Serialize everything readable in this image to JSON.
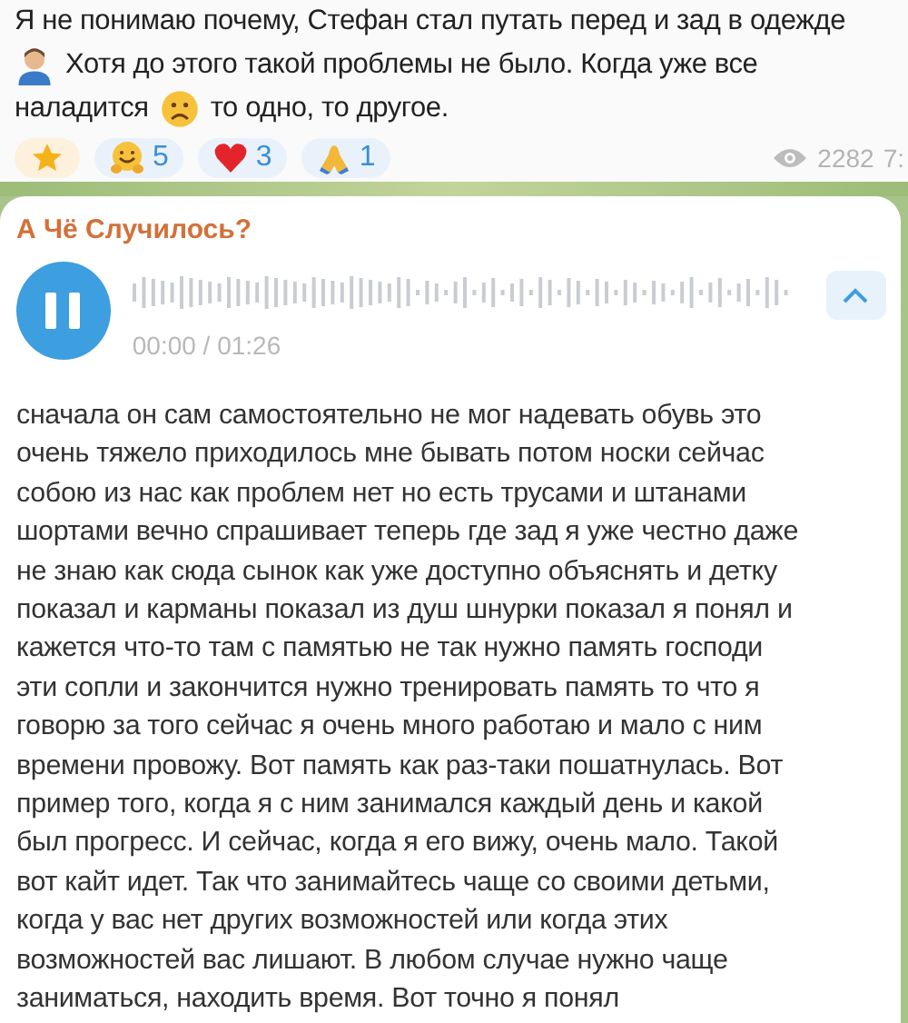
{
  "message": {
    "lines": [
      [
        {
          "kind": "text",
          "text": "Я не понимаю почему, Стефан стал путать перед и зад в одежде"
        }
      ],
      [
        {
          "kind": "person"
        },
        {
          "kind": "text",
          "text": "Хотя до этого такой проблемы не было. Когда уже все"
        }
      ],
      [
        {
          "kind": "text",
          "text": "наладится"
        },
        {
          "kind": "sad"
        },
        {
          "kind": "text",
          "text": "то одно, то другое."
        }
      ]
    ],
    "reactions": [
      {
        "kind": "star"
      },
      {
        "kind": "hug",
        "count": "5"
      },
      {
        "kind": "heart",
        "count": "3"
      },
      {
        "kind": "pray",
        "count": "1"
      }
    ],
    "views": "2282",
    "time": "7:"
  },
  "voice_message": {
    "sender": "А Чё Случилось?",
    "playing": true,
    "duration": "00:00 / 01:26",
    "transcript": [
      "сначала он сам самостоятельно не мог надевать обувь это",
      "очень тяжело приходилось мне бывать потом носки сейчас",
      "собою из нас как проблем нет но есть трусами и штанами",
      "шортами вечно спрашивает теперь где зад я уже честно даже",
      "не знаю как сюда сынок как уже доступно объяснять и детку",
      "показал и карманы показал из душ шнурки показал я понял и",
      "кажется что-то там с памятью не так нужно память господи",
      "эти сопли и закончится нужно тренировать память то что я",
      "говорю за того сейчас я очень много работаю и мало с ним",
      "времени провожу. Вот память как раз-таки пошатнулась. Вот",
      "пример того, когда я с ним занимался каждый день и какой",
      "был прогресс. И сейчас, когда я его вижу, очень мало. Такой",
      "вот кайт идет. Так что занимайтесь чаще со своими детьми,",
      "когда у вас нет других возможностей или когда этих",
      "возможностей вас лишают. В любом случае нужно чаще",
      "заниматься, находить время. Вот точно я понял"
    ]
  }
}
